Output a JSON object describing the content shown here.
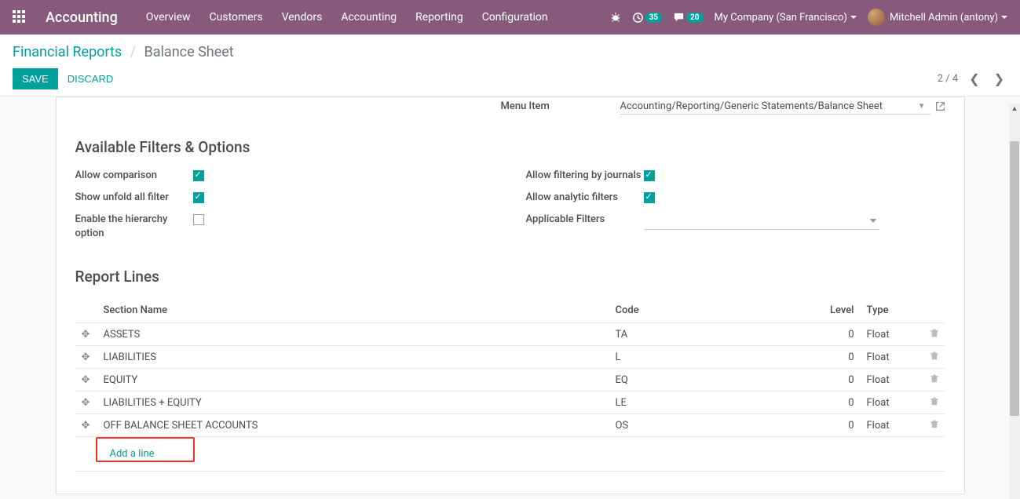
{
  "nav": {
    "brand": "Accounting",
    "menu": [
      "Overview",
      "Customers",
      "Vendors",
      "Accounting",
      "Reporting",
      "Configuration"
    ],
    "clock_badge": "35",
    "chat_badge": "20",
    "company": "My Company (San Francisco)",
    "user": "Mitchell Admin (antony)"
  },
  "breadcrumb": {
    "parent": "Financial Reports",
    "current": "Balance Sheet"
  },
  "buttons": {
    "save": "SAVE",
    "discard": "DISCARD"
  },
  "pager": {
    "text": "2 / 4"
  },
  "menu_item": {
    "label": "Menu Item",
    "value": "Accounting/Reporting/Generic Statements/Balance Sheet"
  },
  "filters_heading": "Available Filters & Options",
  "options_left": [
    {
      "label": "Allow comparison",
      "checked": true
    },
    {
      "label": "Show unfold all filter",
      "checked": true
    },
    {
      "label": "Enable the hierarchy option",
      "checked": false
    }
  ],
  "options_right": [
    {
      "label": "Allow filtering by journals",
      "checked": true,
      "type": "chk"
    },
    {
      "label": "Allow analytic filters",
      "checked": true,
      "type": "chk"
    },
    {
      "label": "Applicable Filters",
      "type": "dropdown"
    }
  ],
  "lines_heading": "Report Lines",
  "columns": {
    "name": "Section Name",
    "code": "Code",
    "level": "Level",
    "type": "Type"
  },
  "rows": [
    {
      "name": "ASSETS",
      "code": "TA",
      "level": "0",
      "type": "Float"
    },
    {
      "name": "LIABILITIES",
      "code": "L",
      "level": "0",
      "type": "Float"
    },
    {
      "name": "EQUITY",
      "code": "EQ",
      "level": "0",
      "type": "Float"
    },
    {
      "name": "LIABILITIES + EQUITY",
      "code": "LE",
      "level": "0",
      "type": "Float"
    },
    {
      "name": "OFF BALANCE SHEET ACCOUNTS",
      "code": "OS",
      "level": "0",
      "type": "Float"
    }
  ],
  "add_line": "Add a line"
}
